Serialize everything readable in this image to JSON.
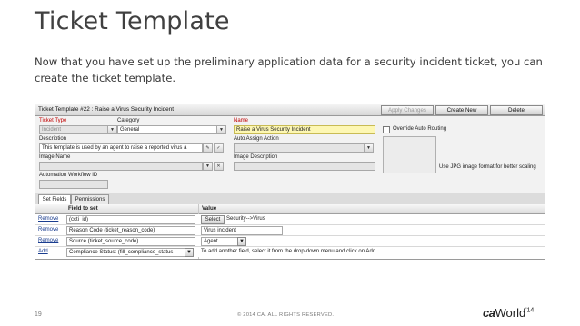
{
  "slide": {
    "title": "Ticket Template",
    "intro": "Now that you have set up the preliminary application data for a security incident ticket, you can create the ticket template.",
    "page_number": "19",
    "copyright": "© 2014 CA. ALL RIGHTS RESERVED.",
    "logo_ca": "ca",
    "logo_world": "World",
    "logo_year": "'14"
  },
  "window": {
    "title": "Ticket Template #22 : Raise a Virus Security Incident",
    "buttons": {
      "apply": "Apply Changes",
      "create": "Create New",
      "delete": "Delete"
    }
  },
  "form": {
    "ticket_type_label": "Ticket Type",
    "ticket_type_value": "Incident",
    "category_label": "Category",
    "category_value": "General",
    "name_label": "Name",
    "name_value": "Raise a Virus Security Incident",
    "override_label": "Override Auto Routing",
    "description_label": "Description",
    "description_value": "This template is used by an agent to raise a reported virus a",
    "auto_assign_label": "Auto Assign Action",
    "image_name_label": "Image Name",
    "image_description_label": "Image Description",
    "automation_label": "Automation Workflow ID",
    "image_hint": "Use JPG image format for better scaling"
  },
  "tabs": [
    "Set Fields",
    "Permissions"
  ],
  "table": {
    "col_field": "Field to set",
    "col_value": "Value",
    "rows": [
      {
        "action": "Remove",
        "field": "(ccti_id)",
        "button": "Select",
        "value": "Security-->Virus"
      },
      {
        "action": "Remove",
        "field": "Reason Code (ticket_reason_code)",
        "value": "Virus incident"
      },
      {
        "action": "Remove",
        "field": "Source (ticket_source_code)",
        "value": "Agent"
      },
      {
        "action": "Add",
        "field": "Compliance Status: (fill_compliance_status",
        "value": "To add another field, select it from the drop-down menu and click on Add."
      }
    ]
  },
  "colors": {
    "title_text": "#404040",
    "required_label": "#c00000",
    "highlight_field": "#fdf7b3",
    "link": "#1a3d8f"
  }
}
